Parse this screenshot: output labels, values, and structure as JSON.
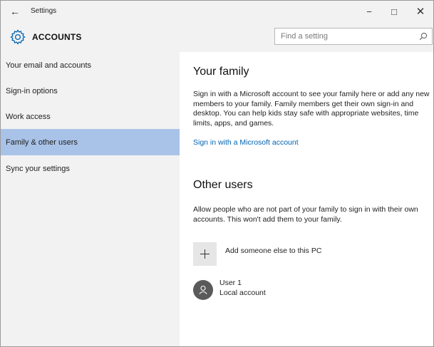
{
  "window": {
    "title": "Settings",
    "back_glyph": "←",
    "minimize_glyph": "−",
    "maximize_glyph": "□",
    "close_glyph": "✕"
  },
  "header": {
    "icon": "gear-icon",
    "section_title": "ACCOUNTS",
    "search_placeholder": "Find a setting",
    "search_icon": "search-icon"
  },
  "sidebar": {
    "items": [
      {
        "label": "Your email and accounts",
        "selected": false
      },
      {
        "label": "Sign-in options",
        "selected": false
      },
      {
        "label": "Work access",
        "selected": false
      },
      {
        "label": "Family & other users",
        "selected": true
      },
      {
        "label": "Sync your settings",
        "selected": false
      }
    ]
  },
  "content": {
    "family_heading": "Your family",
    "family_description": "Sign in with a Microsoft account to see your family here or add any new members to your family. Family members get their own sign-in and desktop. You can help kids stay safe with appropriate websites, time limits, apps, and games.",
    "family_link": "Sign in with a Microsoft account",
    "other_heading": "Other users",
    "other_description": "Allow people who are not part of your family to sign in with their own accounts. This won't add them to your family.",
    "add_label": "Add someone else to this PC",
    "add_icon": "plus-icon",
    "user": {
      "name": "User 1",
      "type": "Local account",
      "icon": "person-icon"
    }
  },
  "colors": {
    "chrome": "#f2f2f2",
    "selected": "#a9c3e8",
    "link": "#0063b1",
    "accent": "#0063b1",
    "avatar": "#5a5a5a"
  }
}
